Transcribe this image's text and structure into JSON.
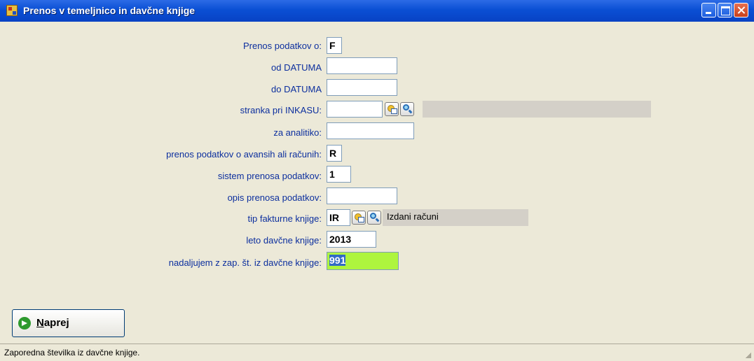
{
  "window": {
    "title": "Prenos v temeljnico in davčne knjige"
  },
  "form": {
    "fields": [
      {
        "label": "Prenos podatkov o:",
        "value": "F"
      },
      {
        "label": "od DATUMA",
        "value": ""
      },
      {
        "label": "do DATUMA",
        "value": ""
      },
      {
        "label": "stranka pri INKASU:",
        "value": "",
        "description": ""
      },
      {
        "label": "za analitiko:",
        "value": ""
      },
      {
        "label": "prenos podatkov o avansih ali računih:",
        "value": "R"
      },
      {
        "label": "sistem prenosa podatkov:",
        "value": "1"
      },
      {
        "label": "opis prenosa podatkov:",
        "value": ""
      },
      {
        "label": "tip fakturne knjige:",
        "value": "IR",
        "description": "Izdani računi"
      },
      {
        "label": "leto davčne knjige:",
        "value": "2013"
      },
      {
        "label": "nadaljujem z zap. št. iz davčne knjige:",
        "value": "991"
      }
    ],
    "highlight_color": "#aef53e",
    "label_color": "#0c2f9e"
  },
  "buttons": {
    "naprej": {
      "label_first": "N",
      "label_rest": "aprej",
      "icon": "go-arrow-icon"
    }
  },
  "statusbar": {
    "text": "Zaporedna številka iz davčne knjige."
  }
}
